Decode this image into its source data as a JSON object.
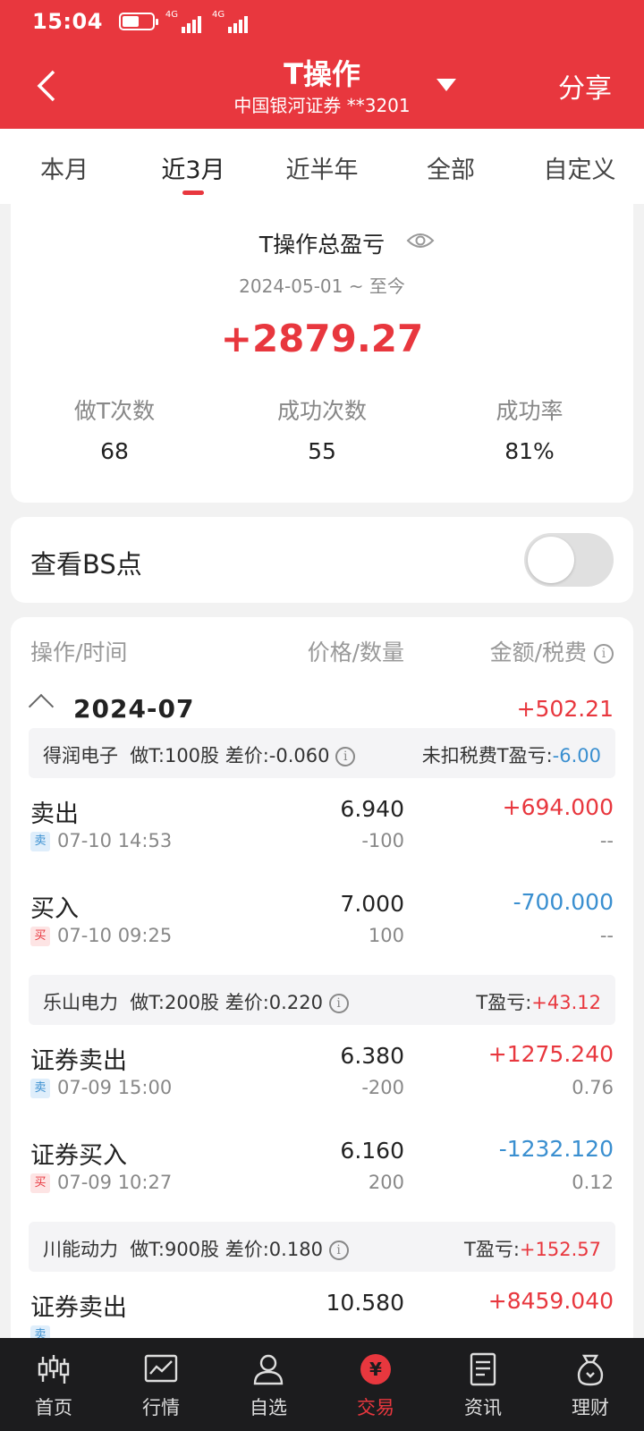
{
  "status_bar": {
    "time": "15:04",
    "battery_level": 0.55,
    "signal1_label": "4G",
    "signal2_label": "4G"
  },
  "header": {
    "title": "T操作",
    "account": "中国银河证券 **3201",
    "share_label": "分享"
  },
  "period_tabs": [
    {
      "label": "本月",
      "active": false
    },
    {
      "label": "近3月",
      "active": true
    },
    {
      "label": "近半年",
      "active": false
    },
    {
      "label": "全部",
      "active": false
    },
    {
      "label": "自定义",
      "active": false
    }
  ],
  "summary": {
    "title": "T操作总盈亏",
    "period": "2024-05-01 ~ 至今",
    "total": "+2879.27",
    "stats": [
      {
        "label": "做T次数",
        "value": "68"
      },
      {
        "label": "成功次数",
        "value": "55"
      },
      {
        "label": "成功率",
        "value": "81%"
      }
    ]
  },
  "bs_toggle": {
    "label": "查看BS点",
    "on": false
  },
  "list": {
    "headers": {
      "op_time": "操作/时间",
      "price_qty": "价格/数量",
      "amount_fee": "金额/税费"
    },
    "month": {
      "label": "2024-07",
      "pl": "+502.21"
    },
    "groups": [
      {
        "stock": "得润电子",
        "t_info": "做T:100股",
        "diff": "差价:-0.060",
        "pl_label": "未扣税费T盈亏:",
        "pl_value": "-6.00",
        "pl_color": "#3a8fd0",
        "rows": [
          {
            "op": "卖出",
            "tag": "卖",
            "side": "sell",
            "time": "07-10 14:53",
            "price": "6.940",
            "qty": "-100",
            "amount": "+694.000",
            "fee": "--"
          },
          {
            "op": "买入",
            "tag": "买",
            "side": "buy",
            "time": "07-10 09:25",
            "price": "7.000",
            "qty": "100",
            "amount": "-700.000",
            "fee": "--"
          }
        ]
      },
      {
        "stock": "乐山电力",
        "t_info": "做T:200股",
        "diff": "差价:0.220",
        "pl_label": "T盈亏:",
        "pl_value": "+43.12",
        "pl_color": "#e8373e",
        "rows": [
          {
            "op": "证券卖出",
            "tag": "卖",
            "side": "sell",
            "time": "07-09 15:00",
            "price": "6.380",
            "qty": "-200",
            "amount": "+1275.240",
            "fee": "0.76"
          },
          {
            "op": "证券买入",
            "tag": "买",
            "side": "buy",
            "time": "07-09 10:27",
            "price": "6.160",
            "qty": "200",
            "amount": "-1232.120",
            "fee": "0.12"
          }
        ]
      },
      {
        "stock": "川能动力",
        "t_info": "做T:900股",
        "diff": "差价:0.180",
        "pl_label": "T盈亏:",
        "pl_value": "+152.57",
        "pl_color": "#e8373e",
        "rows": [
          {
            "op": "证券卖出",
            "tag": "卖",
            "side": "sell",
            "time": "",
            "price": "10.580",
            "qty": "",
            "amount": "+8459.040",
            "fee": ""
          }
        ]
      }
    ]
  },
  "bottom_nav": [
    {
      "label": "首页",
      "icon": "candlestick-icon",
      "active": false
    },
    {
      "label": "行情",
      "icon": "chart-icon",
      "active": false
    },
    {
      "label": "自选",
      "icon": "user-icon",
      "active": false
    },
    {
      "label": "交易",
      "icon": "yuan-icon",
      "active": true
    },
    {
      "label": "资讯",
      "icon": "document-icon",
      "active": false
    },
    {
      "label": "理财",
      "icon": "money-bag-icon",
      "active": false
    }
  ],
  "colors": {
    "brand_red": "#e8373e",
    "loss_blue": "#3a8fd0"
  }
}
